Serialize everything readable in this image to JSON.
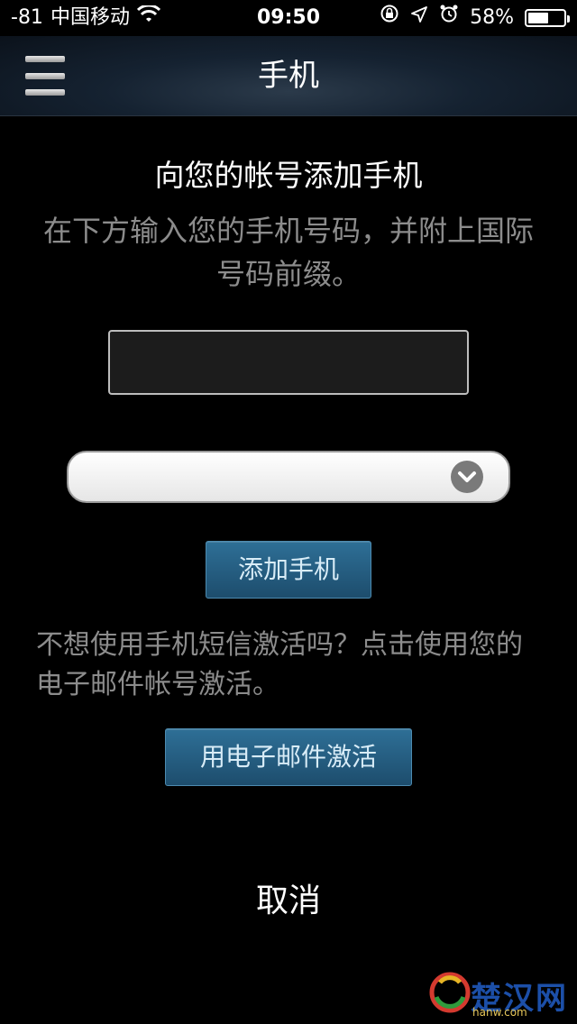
{
  "status_bar": {
    "signal": "-81",
    "carrier": "中国移动",
    "time": "09:50",
    "battery": "58%",
    "battery_level": 0.58
  },
  "nav": {
    "title": "手机"
  },
  "content": {
    "heading": "向您的帐号添加手机",
    "description": "在下方输入您的手机号码，并附上国际号码前缀。",
    "phone_input_value": "",
    "phone_input_placeholder": "",
    "country_select_value": "",
    "add_phone_label": "添加手机",
    "alt_text": "不想使用手机短信激活吗？点击使用您的电子邮件帐号激活。",
    "email_activate_label": "用电子邮件激活",
    "cancel_label": "取消"
  },
  "watermark": {
    "logo_text": "楚汉网",
    "sub_text": "hanw.com"
  },
  "colors": {
    "background": "#000000",
    "button": "#2a6389",
    "muted_text": "#8c8c8c",
    "nav_bg": "#152231"
  }
}
